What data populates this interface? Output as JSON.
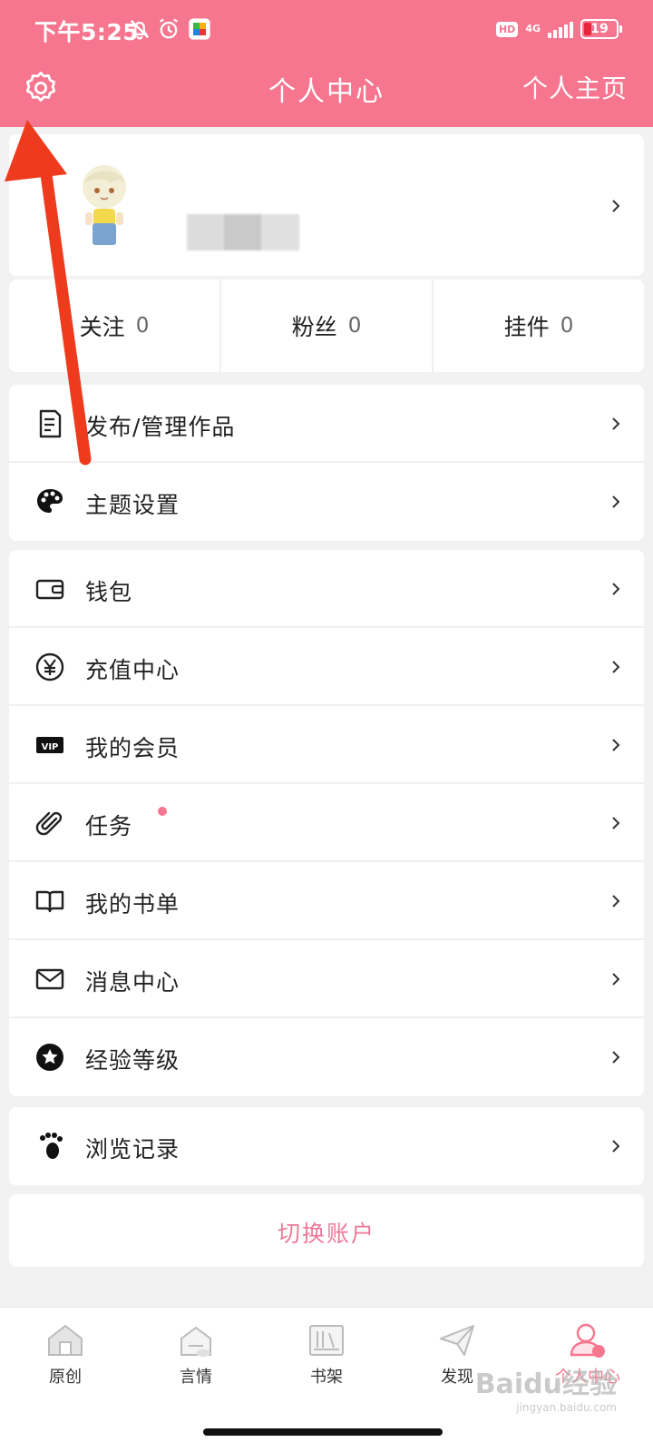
{
  "status_bar": {
    "time": "下午5:25",
    "hd": "HD",
    "network": "4G",
    "battery": "19"
  },
  "header": {
    "title": "个人中心",
    "right_link": "个人主页",
    "settings_icon": "gear-icon"
  },
  "stats": [
    {
      "label": "关注",
      "value": "0"
    },
    {
      "label": "粉丝",
      "value": "0"
    },
    {
      "label": "挂件",
      "value": "0"
    }
  ],
  "menu_group_1": [
    {
      "label": "发布/管理作品",
      "icon": "document-icon"
    },
    {
      "label": "主题设置",
      "icon": "palette-icon"
    }
  ],
  "menu_group_2": [
    {
      "label": "钱包",
      "icon": "wallet-icon"
    },
    {
      "label": "充值中心",
      "icon": "yen-icon"
    },
    {
      "label": "我的会员",
      "icon": "vip-icon"
    },
    {
      "label": "任务",
      "icon": "paperclip-icon"
    },
    {
      "label": "我的书单",
      "icon": "book-icon"
    },
    {
      "label": "消息中心",
      "icon": "mail-icon"
    },
    {
      "label": "经验等级",
      "icon": "star-icon"
    }
  ],
  "menu_group_3": [
    {
      "label": "浏览记录",
      "icon": "footprint-icon"
    }
  ],
  "switch_account": "切换账户",
  "bottom_nav": [
    {
      "label": "原创",
      "icon": "house-icon"
    },
    {
      "label": "言情",
      "icon": "house-outline-icon"
    },
    {
      "label": "书架",
      "icon": "bookshelf-icon"
    },
    {
      "label": "发现",
      "icon": "paper-plane-icon"
    },
    {
      "label": "个人中心",
      "icon": "user-icon",
      "active": true
    }
  ],
  "watermark": "Baidu经验",
  "watermark_sub": "jingyan.baidu.com",
  "colors": {
    "brand_pink": "#f6758f",
    "switch_text": "#ee7a99",
    "annotation_arrow": "#ee3b1e"
  }
}
